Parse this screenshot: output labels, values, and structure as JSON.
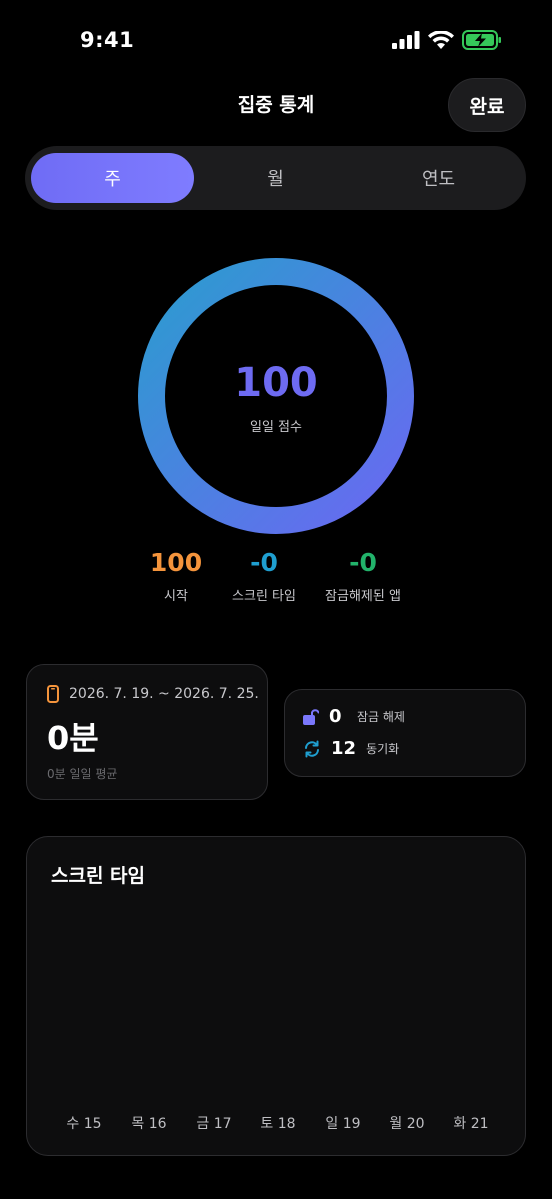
{
  "status": {
    "time": "9:41",
    "icons": [
      "signal-icon",
      "wifi-icon",
      "battery-charging-icon"
    ]
  },
  "nav": {
    "title": "집중 통계",
    "done_label": "완료"
  },
  "segments": [
    {
      "label": "주",
      "active": true
    },
    {
      "label": "월",
      "active": false
    },
    {
      "label": "연도",
      "active": false
    }
  ],
  "score": {
    "value": "100",
    "label": "일일 점수",
    "progress": 1.0
  },
  "stats": [
    {
      "value": "100",
      "label": "시작",
      "color": "#f4943c"
    },
    {
      "value": "-0",
      "label": "스크린 타임",
      "color": "#1f9fd0"
    },
    {
      "value": "-0",
      "label": "잠금해제된 앱",
      "color": "#22b36b"
    }
  ],
  "range_card": {
    "range": "2026. 7. 19. ~ 2026. 7. 25.",
    "total": "0분",
    "average": "0분 일일 평균"
  },
  "unlock_card": {
    "unlocks": {
      "value": "0",
      "label": "잠금 해제"
    },
    "syncs": {
      "value": "12",
      "label": "동기화"
    }
  },
  "chart_card": {
    "title": "스크린 타임",
    "days": [
      "수 15",
      "목 16",
      "금 17",
      "토 18",
      "일 19",
      "월 20",
      "화 21"
    ]
  },
  "colors": {
    "accent": "#7a77fb",
    "ring_start": "#2b9ccf",
    "ring_end": "#6a68f2"
  }
}
